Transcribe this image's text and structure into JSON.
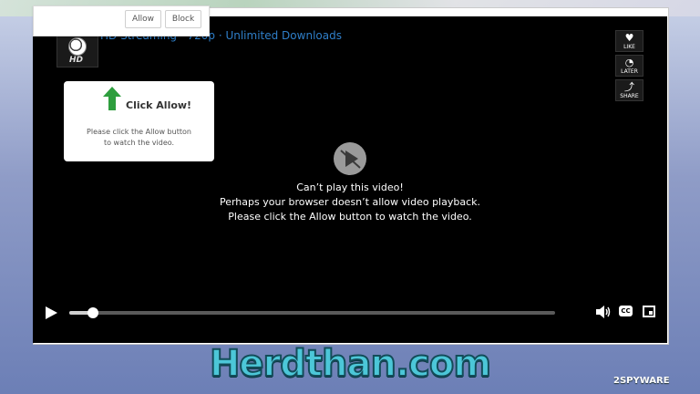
{
  "permission": {
    "allow_label": "Allow",
    "block_label": "Block"
  },
  "header": {
    "title": "HD Streaming · 720p · Unlimited Downloads",
    "thumb_text": "HD"
  },
  "side_actions": [
    {
      "label": "LIKE",
      "icon": "heart-icon"
    },
    {
      "label": "LATER",
      "icon": "clock-icon"
    },
    {
      "label": "SHARE",
      "icon": "share-icon"
    }
  ],
  "click_card": {
    "title": "Click Allow!",
    "line1": "Please click the Allow button",
    "line2": "to watch the video."
  },
  "center_message": {
    "line1": "Can’t play this video!",
    "line2": "Perhaps your browser doesn’t allow video playback.",
    "line3": "Please click the Allow button to watch the video."
  },
  "controls": {
    "progress": 0.03,
    "cc_label": "CC"
  },
  "watermark": {
    "text": "Herdthan.com",
    "logo": "2SPYWARE"
  },
  "colors": {
    "accent": "#2f7fc9",
    "watermark": "#4cc7d8"
  }
}
